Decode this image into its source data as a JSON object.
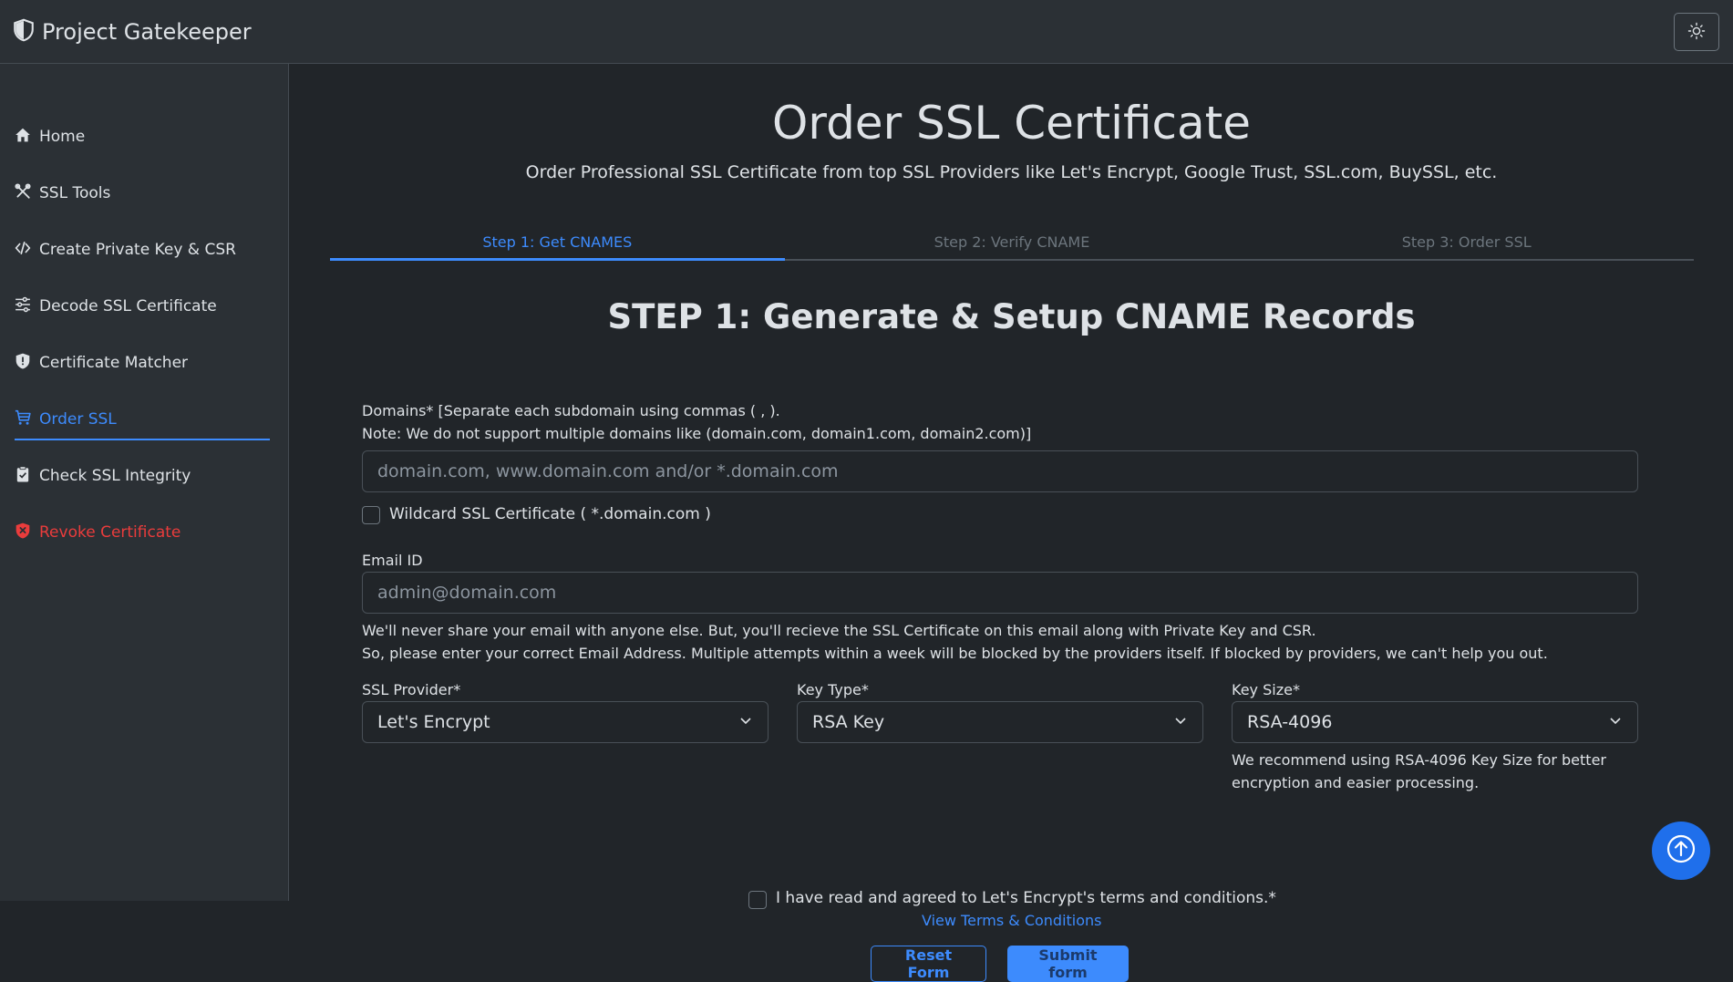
{
  "app": {
    "title": "Project Gatekeeper",
    "logo_icon": "shield-half-icon",
    "theme_icon": "sun-icon"
  },
  "sidebar": {
    "items": [
      {
        "label": "Home",
        "icon": "house-icon"
      },
      {
        "label": "SSL Tools",
        "icon": "tools-icon"
      },
      {
        "label": "Create Private Key & CSR",
        "icon": "code-icon"
      },
      {
        "label": "Decode SSL Certificate",
        "icon": "sliders-icon"
      },
      {
        "label": "Certificate Matcher",
        "icon": "shield-exclamation-icon"
      },
      {
        "label": "Order SSL",
        "icon": "cart-icon",
        "active": true
      },
      {
        "label": "Check SSL Integrity",
        "icon": "clipboard-check-icon"
      },
      {
        "label": "Revoke Certificate",
        "icon": "shield-x-icon",
        "danger": true
      }
    ]
  },
  "page": {
    "title": "Order SSL Certificate",
    "subtitle": "Order Professional SSL Certificate from top SSL Providers like Let's Encrypt, Google Trust, SSL.com, BuySSL, etc."
  },
  "steps": [
    {
      "label": "Step 1: Get CNAMES",
      "active": true
    },
    {
      "label": "Step 2: Verify CNAME",
      "active": false
    },
    {
      "label": "Step 3: Order SSL",
      "active": false
    }
  ],
  "form": {
    "section_title": "STEP 1: Generate & Setup CNAME Records",
    "domains_label_1": "Domains* [Separate each subdomain using commas ( , ).",
    "domains_label_2": "Note: We do not support multiple domains like (domain.com, domain1.com, domain2.com)]",
    "domains_placeholder": "domain.com, www.domain.com and/or *.domain.com",
    "wildcard_label": "Wildcard SSL Certificate ( *.domain.com )",
    "email_label": "Email ID",
    "email_placeholder": "admin@domain.com",
    "email_help_1": "We'll never share your email with anyone else. But, you'll recieve the SSL Certificate on this email along with Private Key and CSR.",
    "email_help_2": "So, please enter your correct Email Address. Multiple attempts within a week will be blocked by the providers itself. If blocked by providers, we can't help you out.",
    "provider_label": "SSL Provider*",
    "provider_value": "Let's Encrypt",
    "key_type_label": "Key Type*",
    "key_type_value": "RSA Key",
    "key_size_label": "Key Size*",
    "key_size_value": "RSA-4096",
    "key_size_help_1": "We recommend using RSA-4096 Key Size for better",
    "key_size_help_2": "encryption and easier processing.",
    "terms_label": "I have read and agreed to Let's Encrypt's terms and conditions.*",
    "terms_link": "View Terms & Conditions",
    "reset_label": "Reset Form",
    "submit_label": "Submit form"
  },
  "colors": {
    "accent": "#3d8bfd",
    "danger": "#ea3c3c",
    "bg": "#212529",
    "panel": "#2b3035"
  }
}
